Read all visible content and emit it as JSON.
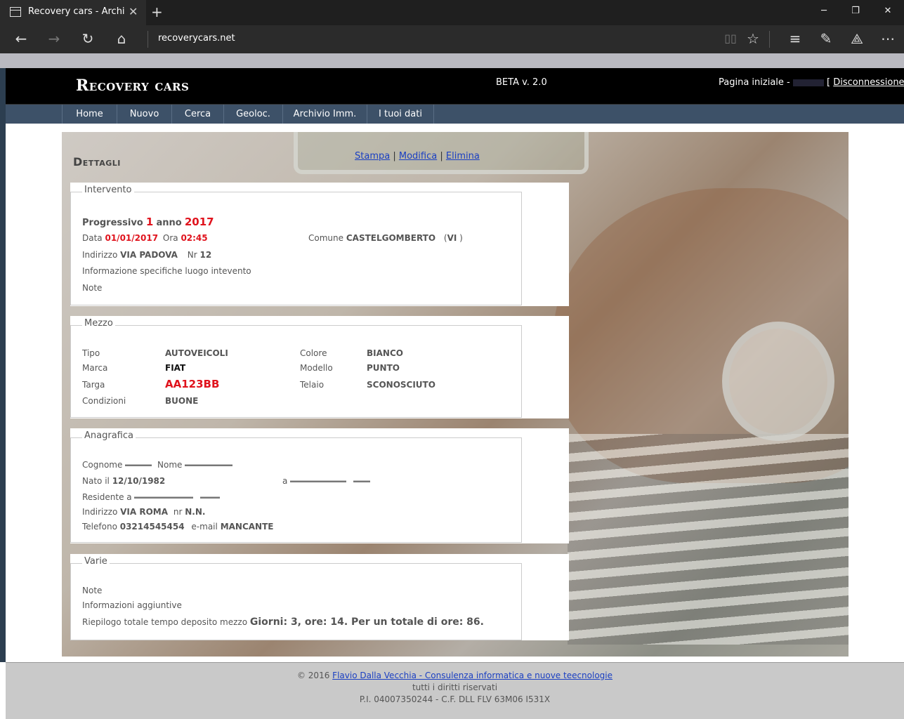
{
  "browser": {
    "tab_title": "Recovery cars - Archivio",
    "url": "recoverycars.net"
  },
  "site": {
    "logo": "Recovery cars",
    "version": "BETA v. 2.0",
    "home_label": "Pagina iniziale -",
    "logout_open": "[",
    "logout_label": "Disconnessione",
    "logout_close": "]"
  },
  "menu": [
    {
      "label": "Home"
    },
    {
      "label": "Nuovo"
    },
    {
      "label": "Cerca"
    },
    {
      "label": "Geoloc."
    },
    {
      "label": "Archivio Imm."
    },
    {
      "label": "I tuoi dati"
    }
  ],
  "page": {
    "title": "Dettagli",
    "actions": {
      "print": "Stampa",
      "edit": "Modifica",
      "delete": "Elimina",
      "sep": "|"
    }
  },
  "intervento": {
    "legend": "Intervento",
    "progressivo_label": "Progressivo",
    "progressivo": "1",
    "anno_label": "anno",
    "anno": "2017",
    "data_label": "Data",
    "data": "01/01/2017",
    "ora_label": "Ora",
    "ora": "02:45",
    "comune_label": "Comune",
    "comune": "CASTELGOMBERTO",
    "provincia": "VI",
    "indirizzo_label": "Indirizzo",
    "indirizzo": "VIA PADOVA",
    "nr_label": "Nr",
    "nr": "12",
    "info_label": "Informazione specifiche luogo intevento",
    "note_label": "Note"
  },
  "mezzo": {
    "legend": "Mezzo",
    "tipo_label": "Tipo",
    "tipo": "AUTOVEICOLI",
    "colore_label": "Colore",
    "colore": "BIANCO",
    "marca_label": "Marca",
    "marca": "FIAT",
    "modello_label": "Modello",
    "modello": "PUNTO",
    "targa_label": "Targa",
    "targa": "AA123BB",
    "telaio_label": "Telaio",
    "telaio": "SCONOSCIUTO",
    "condizioni_label": "Condizioni",
    "condizioni": "BUONE"
  },
  "anagrafica": {
    "legend": "Anagrafica",
    "cognome_label": "Cognome",
    "nome_label": "Nome",
    "nato_label": "Nato il",
    "nato": "12/10/1982",
    "luogo_label": "a",
    "residente_label": "Residente a",
    "indirizzo_label": "Indirizzo",
    "indirizzo": "VIA ROMA",
    "nr_label": "nr",
    "nr": "N.N.",
    "telefono_label": "Telefono",
    "telefono": "03214545454",
    "email_label": "e-mail",
    "email": "MANCANTE"
  },
  "varie": {
    "legend": "Varie",
    "note_label": "Note",
    "info_label": "Informazioni aggiuntive",
    "riepilogo_label": "Riepilogo totale tempo deposito mezzo",
    "riepilogo": "Giorni: 3, ore: 14. Per un totale di ore: 86."
  },
  "footer": {
    "copyright": "© 2016",
    "author_link": "Flavio Dalla Vecchia - Consulenza informatica e nuove teecnologie",
    "rights": "tutti i diritti riservati",
    "piva": "P.I. 04007350244 - C.F. DLL FLV 63M06 I531X"
  }
}
